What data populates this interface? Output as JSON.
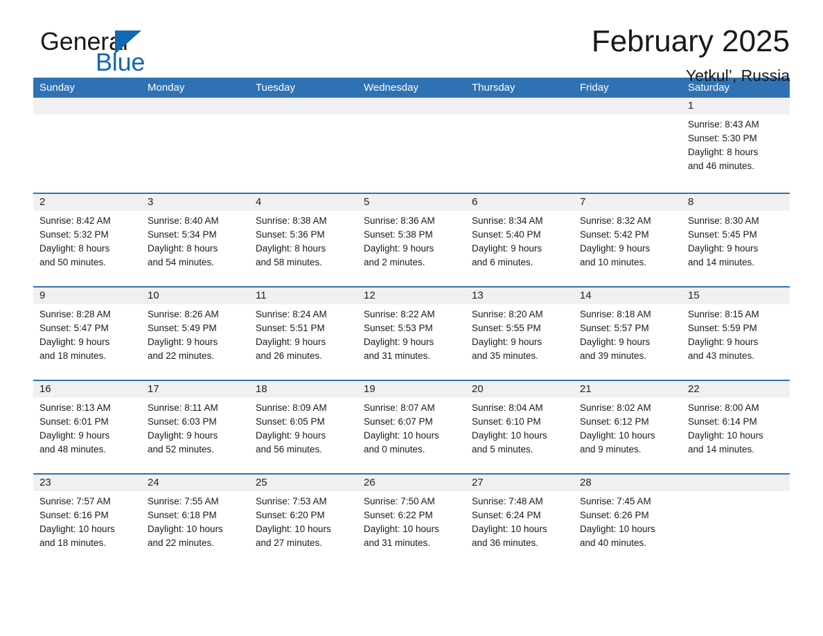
{
  "brand": {
    "word1": "General",
    "word2": "Blue",
    "triangle_color": "#1268b3",
    "blue": "#1268b3"
  },
  "header": {
    "title": "February 2025",
    "location": "Yetkul’, Russia"
  },
  "theme": {
    "header_bg": "#2f72b4",
    "header_text": "#ffffff",
    "row_divider": "#2f72b4",
    "daynum_bg": "#f0f0f0",
    "body_text": "#1a1a1a",
    "page_bg": "#ffffff"
  },
  "weekdays": [
    "Sunday",
    "Monday",
    "Tuesday",
    "Wednesday",
    "Thursday",
    "Friday",
    "Saturday"
  ],
  "weeks": [
    [
      {
        "day": "",
        "lines": []
      },
      {
        "day": "",
        "lines": []
      },
      {
        "day": "",
        "lines": []
      },
      {
        "day": "",
        "lines": []
      },
      {
        "day": "",
        "lines": []
      },
      {
        "day": "",
        "lines": []
      },
      {
        "day": "1",
        "lines": [
          "Sunrise: 8:43 AM",
          "Sunset: 5:30 PM",
          "Daylight: 8 hours",
          "and 46 minutes."
        ]
      }
    ],
    [
      {
        "day": "2",
        "lines": [
          "Sunrise: 8:42 AM",
          "Sunset: 5:32 PM",
          "Daylight: 8 hours",
          "and 50 minutes."
        ]
      },
      {
        "day": "3",
        "lines": [
          "Sunrise: 8:40 AM",
          "Sunset: 5:34 PM",
          "Daylight: 8 hours",
          "and 54 minutes."
        ]
      },
      {
        "day": "4",
        "lines": [
          "Sunrise: 8:38 AM",
          "Sunset: 5:36 PM",
          "Daylight: 8 hours",
          "and 58 minutes."
        ]
      },
      {
        "day": "5",
        "lines": [
          "Sunrise: 8:36 AM",
          "Sunset: 5:38 PM",
          "Daylight: 9 hours",
          "and 2 minutes."
        ]
      },
      {
        "day": "6",
        "lines": [
          "Sunrise: 8:34 AM",
          "Sunset: 5:40 PM",
          "Daylight: 9 hours",
          "and 6 minutes."
        ]
      },
      {
        "day": "7",
        "lines": [
          "Sunrise: 8:32 AM",
          "Sunset: 5:42 PM",
          "Daylight: 9 hours",
          "and 10 minutes."
        ]
      },
      {
        "day": "8",
        "lines": [
          "Sunrise: 8:30 AM",
          "Sunset: 5:45 PM",
          "Daylight: 9 hours",
          "and 14 minutes."
        ]
      }
    ],
    [
      {
        "day": "9",
        "lines": [
          "Sunrise: 8:28 AM",
          "Sunset: 5:47 PM",
          "Daylight: 9 hours",
          "and 18 minutes."
        ]
      },
      {
        "day": "10",
        "lines": [
          "Sunrise: 8:26 AM",
          "Sunset: 5:49 PM",
          "Daylight: 9 hours",
          "and 22 minutes."
        ]
      },
      {
        "day": "11",
        "lines": [
          "Sunrise: 8:24 AM",
          "Sunset: 5:51 PM",
          "Daylight: 9 hours",
          "and 26 minutes."
        ]
      },
      {
        "day": "12",
        "lines": [
          "Sunrise: 8:22 AM",
          "Sunset: 5:53 PM",
          "Daylight: 9 hours",
          "and 31 minutes."
        ]
      },
      {
        "day": "13",
        "lines": [
          "Sunrise: 8:20 AM",
          "Sunset: 5:55 PM",
          "Daylight: 9 hours",
          "and 35 minutes."
        ]
      },
      {
        "day": "14",
        "lines": [
          "Sunrise: 8:18 AM",
          "Sunset: 5:57 PM",
          "Daylight: 9 hours",
          "and 39 minutes."
        ]
      },
      {
        "day": "15",
        "lines": [
          "Sunrise: 8:15 AM",
          "Sunset: 5:59 PM",
          "Daylight: 9 hours",
          "and 43 minutes."
        ]
      }
    ],
    [
      {
        "day": "16",
        "lines": [
          "Sunrise: 8:13 AM",
          "Sunset: 6:01 PM",
          "Daylight: 9 hours",
          "and 48 minutes."
        ]
      },
      {
        "day": "17",
        "lines": [
          "Sunrise: 8:11 AM",
          "Sunset: 6:03 PM",
          "Daylight: 9 hours",
          "and 52 minutes."
        ]
      },
      {
        "day": "18",
        "lines": [
          "Sunrise: 8:09 AM",
          "Sunset: 6:05 PM",
          "Daylight: 9 hours",
          "and 56 minutes."
        ]
      },
      {
        "day": "19",
        "lines": [
          "Sunrise: 8:07 AM",
          "Sunset: 6:07 PM",
          "Daylight: 10 hours",
          "and 0 minutes."
        ]
      },
      {
        "day": "20",
        "lines": [
          "Sunrise: 8:04 AM",
          "Sunset: 6:10 PM",
          "Daylight: 10 hours",
          "and 5 minutes."
        ]
      },
      {
        "day": "21",
        "lines": [
          "Sunrise: 8:02 AM",
          "Sunset: 6:12 PM",
          "Daylight: 10 hours",
          "and 9 minutes."
        ]
      },
      {
        "day": "22",
        "lines": [
          "Sunrise: 8:00 AM",
          "Sunset: 6:14 PM",
          "Daylight: 10 hours",
          "and 14 minutes."
        ]
      }
    ],
    [
      {
        "day": "23",
        "lines": [
          "Sunrise: 7:57 AM",
          "Sunset: 6:16 PM",
          "Daylight: 10 hours",
          "and 18 minutes."
        ]
      },
      {
        "day": "24",
        "lines": [
          "Sunrise: 7:55 AM",
          "Sunset: 6:18 PM",
          "Daylight: 10 hours",
          "and 22 minutes."
        ]
      },
      {
        "day": "25",
        "lines": [
          "Sunrise: 7:53 AM",
          "Sunset: 6:20 PM",
          "Daylight: 10 hours",
          "and 27 minutes."
        ]
      },
      {
        "day": "26",
        "lines": [
          "Sunrise: 7:50 AM",
          "Sunset: 6:22 PM",
          "Daylight: 10 hours",
          "and 31 minutes."
        ]
      },
      {
        "day": "27",
        "lines": [
          "Sunrise: 7:48 AM",
          "Sunset: 6:24 PM",
          "Daylight: 10 hours",
          "and 36 minutes."
        ]
      },
      {
        "day": "28",
        "lines": [
          "Sunrise: 7:45 AM",
          "Sunset: 6:26 PM",
          "Daylight: 10 hours",
          "and 40 minutes."
        ]
      },
      {
        "day": "",
        "lines": []
      }
    ]
  ]
}
